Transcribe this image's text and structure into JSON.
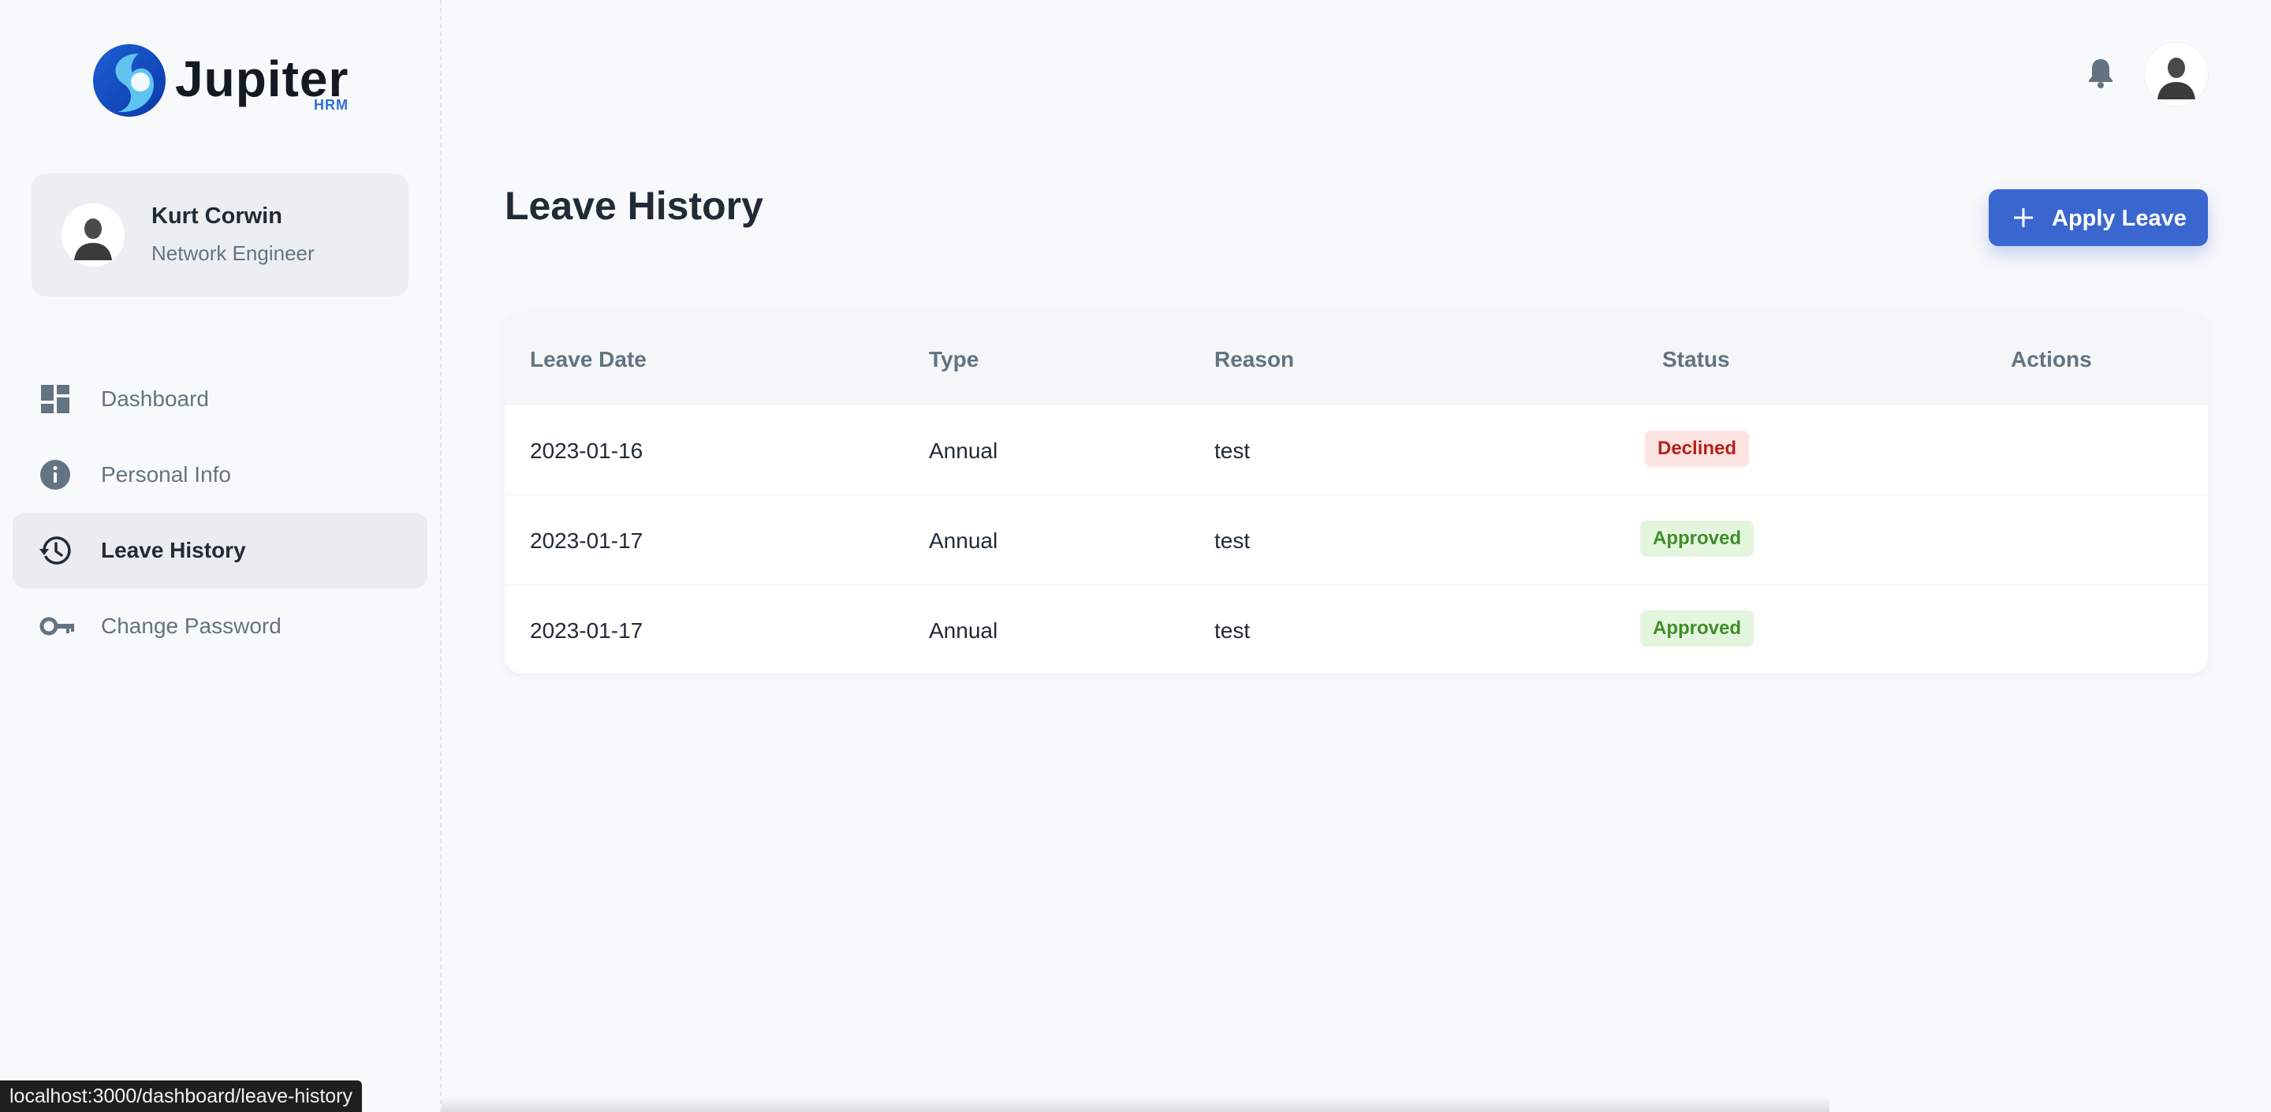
{
  "brand": {
    "name": "Jupiter",
    "sub": "HRM",
    "accent": "#3a66cf"
  },
  "user": {
    "name": "Kurt Corwin",
    "role": "Network Engineer"
  },
  "nav": {
    "items": [
      {
        "label": "Dashboard",
        "icon": "dashboard-icon",
        "active": false
      },
      {
        "label": "Personal Info",
        "icon": "info-icon",
        "active": false
      },
      {
        "label": "Leave History",
        "icon": "history-icon",
        "active": true
      },
      {
        "label": "Change Password",
        "icon": "key-icon",
        "active": false
      }
    ]
  },
  "header": {
    "notifications_icon": "bell-icon"
  },
  "page": {
    "title": "Leave History",
    "apply_button": "Apply Leave"
  },
  "table": {
    "columns": [
      "Leave Date",
      "Type",
      "Reason",
      "Status",
      "Actions"
    ],
    "rows": [
      {
        "date": "2023-01-16",
        "type": "Annual",
        "reason": "test",
        "status": "Declined"
      },
      {
        "date": "2023-01-17",
        "type": "Annual",
        "reason": "test",
        "status": "Approved"
      },
      {
        "date": "2023-01-17",
        "type": "Annual",
        "reason": "test",
        "status": "Approved"
      }
    ]
  },
  "status_colors": {
    "Declined": "#b42318",
    "Approved": "#3e8e2a"
  },
  "browser_status": "localhost:3000/dashboard/leave-history"
}
